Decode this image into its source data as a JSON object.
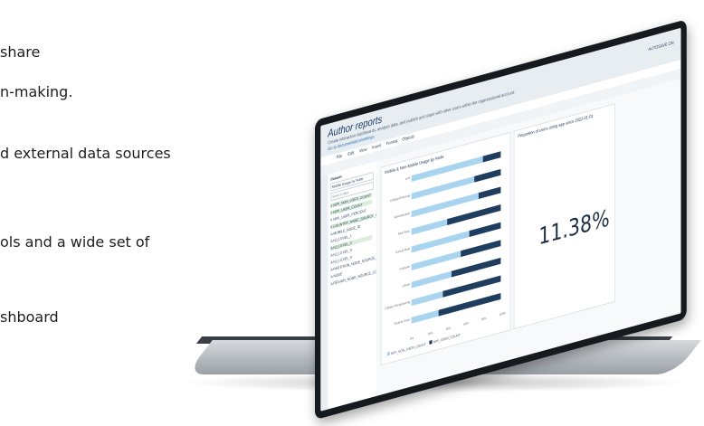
{
  "marketing": {
    "line1": "share",
    "line2": "n-making.",
    "line3": "d external data sources",
    "line4": "ols and a wide set of",
    "line5": "shboard"
  },
  "app": {
    "report_title": "Author reports",
    "report_desc": "Create interactive dashboards, analyze data, and publish and share with other users within the organizational account.",
    "report_link": "Go to documentation/settings",
    "menu": [
      "File",
      "Edit",
      "View",
      "Insert",
      "Format",
      "Objects"
    ],
    "top_right_label": "AUTOSAVE ON",
    "sidebar_panel_title": "Dataset",
    "dataset_name": "Mobile Usage by Node",
    "search_placeholder": "Search data",
    "fields": [
      {
        "label": "# NPP_NON_USER_COUNT",
        "highlighted": true
      },
      {
        "label": "# NPP_USER_COUNT",
        "highlighted": true
      },
      {
        "label": "# NPP_USER_PERCENT",
        "highlighted": false
      },
      {
        "label": "# COUNTRY_NAME_SOURCE_CODE",
        "highlighted": true
      },
      {
        "label": "A  MOBILE_NODE_ID",
        "highlighted": false
      },
      {
        "label": "A  NJ_LEVEL_1",
        "highlighted": false
      },
      {
        "label": "A  NJ_LEVEL_2",
        "highlighted": true
      },
      {
        "label": "A  NJ_LEVEL_3",
        "highlighted": false
      },
      {
        "label": "A  NJ_LEVEL_4",
        "highlighted": false
      },
      {
        "label": "A  PARTITION_NODE_SOURCE_C",
        "highlighted": false
      },
      {
        "label": "A  NODE",
        "highlighted": false
      },
      {
        "label": "A  REGION_NODE_SOURCE_CODE",
        "highlighted": false
      }
    ],
    "chart_card_title": "Mobile & Non-Mobile Usage by Node",
    "kpi_card_title": "Proportion of users using app since 2022-01-01",
    "kpi_value": "11.38%",
    "legend": [
      "NPP_NON_USER_COUNT",
      "NPP_USER_COUNT"
    ]
  },
  "chart_data": {
    "type": "bar",
    "orientation": "horizontal",
    "stacked": true,
    "title": "Mobile & Non-Mobile Usage by Node",
    "categories": [
      "Lodi",
      "Collegeof Nursing",
      "Administration",
      "Park Place",
      "Central Plant",
      "Graduate",
      "Library",
      "College of Engineering",
      "Student Union"
    ],
    "series": [
      {
        "name": "NPP_NON_USER_COUNT",
        "values": [
          80,
          70,
          75,
          40,
          65,
          55,
          45,
          35,
          30
        ]
      },
      {
        "name": "NPP_USER_COUNT",
        "values": [
          20,
          30,
          25,
          60,
          35,
          45,
          55,
          65,
          70
        ]
      }
    ],
    "xticks": [
      "0%",
      "20%",
      "40%",
      "60%",
      "80%",
      "100%"
    ],
    "xlim": [
      0,
      100
    ],
    "colors": [
      "#a8d4ef",
      "#1f3d5e"
    ]
  }
}
